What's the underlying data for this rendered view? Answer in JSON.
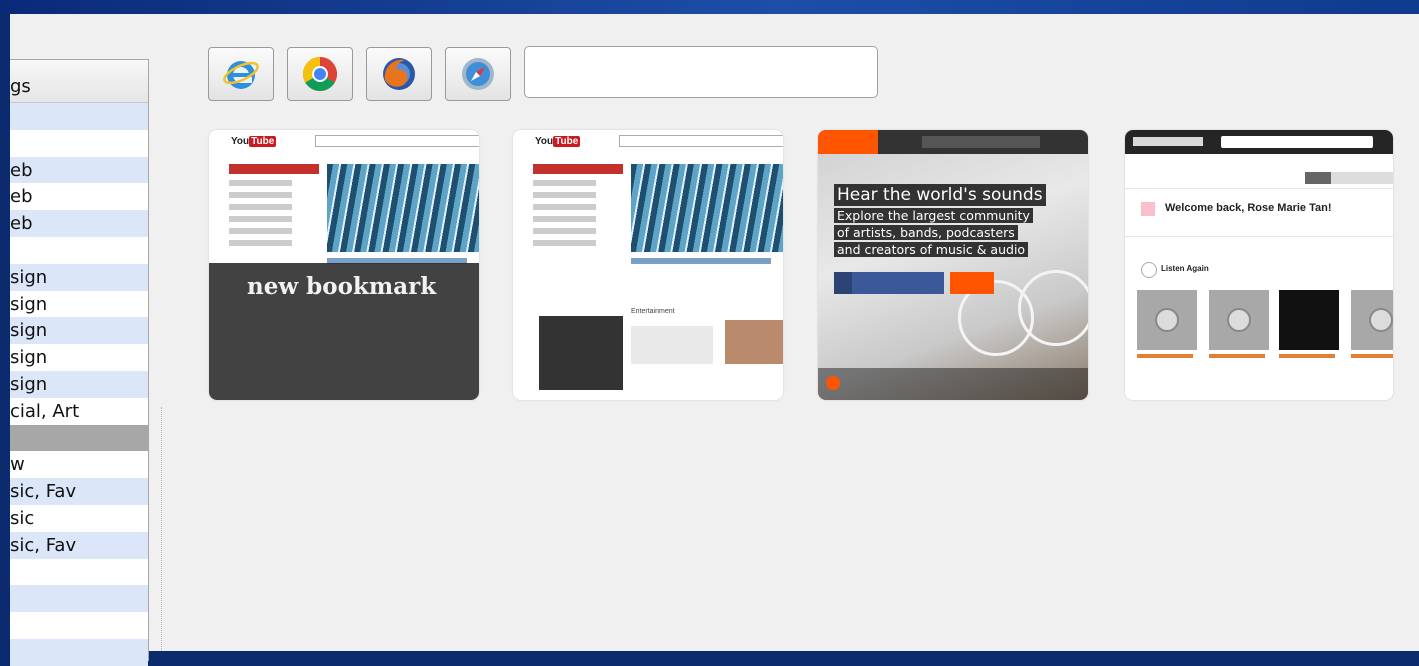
{
  "list": {
    "header": "gs",
    "rows": [
      "",
      "",
      "eb",
      "eb",
      "eb",
      "",
      "sign",
      "sign",
      "sign",
      "sign",
      "sign",
      "cial, Art",
      "",
      "w",
      "sic, Fav",
      "sic",
      "sic, Fav",
      "",
      "",
      "",
      ""
    ],
    "selected_index": 12
  },
  "toolbar": {
    "browsers": [
      {
        "name": "Internet Explorer",
        "icon": "ie-icon"
      },
      {
        "name": "Chrome",
        "icon": "chrome-icon"
      },
      {
        "name": "Firefox",
        "icon": "firefox-icon"
      },
      {
        "name": "Safari",
        "icon": "safari-icon"
      }
    ],
    "url_value": ""
  },
  "thumbnails": {
    "overlay_label": "new bookmark",
    "soundcloud": {
      "headline": "Hear the world's sounds",
      "lines": [
        "Explore the largest community",
        "of artists, bands, podcasters",
        "and creators of music & audio"
      ]
    },
    "grooveshark": {
      "welcome": "Welcome back, Rose Marie Tan!",
      "listen_again": "Listen Again"
    }
  },
  "colors": {
    "desktop": "#0c2a6e",
    "window": "#f0f0f0",
    "row_alt": "#dbe7f8",
    "selected_row": "#a7a7a7",
    "soundcloud_orange": "#ff5500",
    "youtube_red": "#cc181e"
  }
}
